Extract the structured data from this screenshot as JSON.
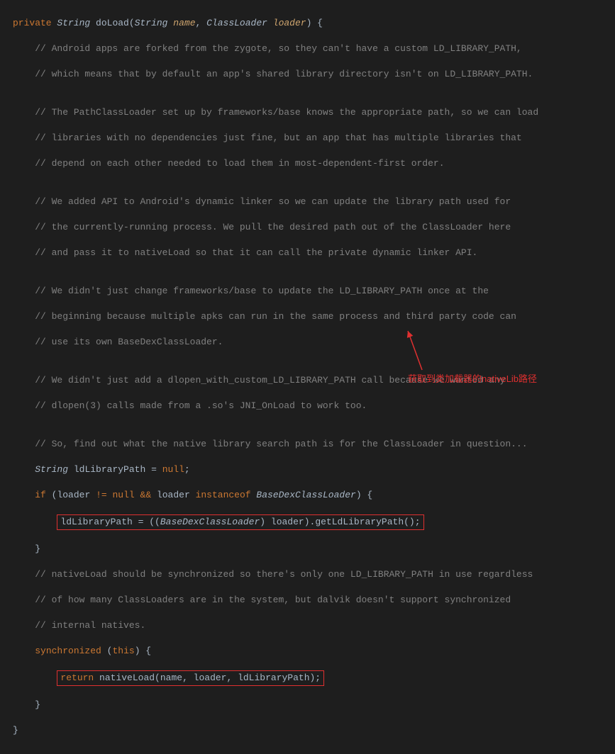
{
  "code": {
    "l0_kw1": "private",
    "l0_type": "String",
    "l0_method": "doLoad",
    "l0_ptype1": "String",
    "l0_pname1": "name",
    "l0_ptype2": "ClassLoader",
    "l0_pname2": "loader",
    "c1": "// Android apps are forked from the zygote, so they can't have a custom LD_LIBRARY_PATH,",
    "c2": "// which means that by default an app's shared library directory isn't on LD_LIBRARY_PATH.",
    "c3": "// The PathClassLoader set up by frameworks/base knows the appropriate path, so we can load",
    "c4": "// libraries with no dependencies just fine, but an app that has multiple libraries that",
    "c5": "// depend on each other needed to load them in most-dependent-first order.",
    "c6": "// We added API to Android's dynamic linker so we can update the library path used for",
    "c7": "// the currently-running process. We pull the desired path out of the ClassLoader here",
    "c8": "// and pass it to nativeLoad so that it can call the private dynamic linker API.",
    "c9": "// We didn't just change frameworks/base to update the LD_LIBRARY_PATH once at the",
    "c10": "// beginning because multiple apks can run in the same process and third party code can",
    "c11": "// use its own BaseDexClassLoader.",
    "c12": "// We didn't just add a dlopen_with_custom_LD_LIBRARY_PATH call because we wanted any",
    "c13": "// dlopen(3) calls made from a .so's JNI_OnLoad to work too.",
    "c14": "// So, find out what the native library search path is for the ClassLoader in question...",
    "d1_type": "String",
    "d1_var": "ldLibraryPath",
    "d1_null": "null",
    "if_kw": "if",
    "if_loader": "loader",
    "if_null": "null",
    "if_and": "&&",
    "if_loader2": "loader",
    "if_inst": "instanceof",
    "if_bdcl": "BaseDexClassLoader",
    "box1_lhs": "ldLibraryPath = ((",
    "box1_bdcl": "BaseDexClassLoader",
    "box1_mid": ") loader).",
    "box1_call": "getLdLibraryPath()",
    "box1_semi": ";",
    "c15": "// nativeLoad should be synchronized so there's only one LD_LIBRARY_PATH in use regardless",
    "c16": "// of how many ClassLoaders are in the system, but dalvik doesn't support synchronized",
    "c17": "// internal natives.",
    "sync_kw": "synchronized",
    "sync_this": "this",
    "box2_ret": "return",
    "box2_call": "nativeLoad(name, loader, ldLibraryPath);",
    "annotation": "获取到类加载器的nativeLib路径"
  }
}
